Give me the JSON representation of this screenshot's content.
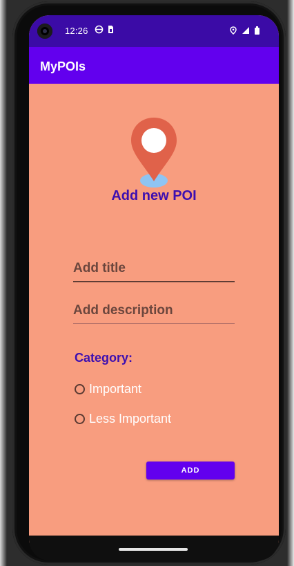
{
  "status_bar": {
    "time": "12:26",
    "icons": [
      "data-saver-icon",
      "sim-card-icon",
      "location-icon",
      "signal-icon",
      "battery-icon"
    ]
  },
  "app_bar": {
    "title": "MyPOIs"
  },
  "header": {
    "icon": "map-pin-icon",
    "title": "Add new POI"
  },
  "form": {
    "title_placeholder": "Add title",
    "title_value": "",
    "description_placeholder": "Add description",
    "description_value": "",
    "category_label": "Category:",
    "category_options": [
      "Important",
      "Less Important"
    ],
    "selected_category": ""
  },
  "actions": {
    "add_label": "ADD"
  },
  "colors": {
    "status_bar": "#3b0ba6",
    "app_bar": "#6200ee",
    "screen_background": "#f89d7f",
    "heading_text": "#3d0fb0",
    "pin_red": "#e0624a",
    "pin_shadow": "#8fc4f2",
    "button_bg": "#6200ee"
  }
}
